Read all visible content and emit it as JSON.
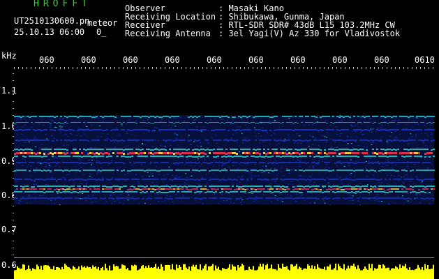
{
  "header": {
    "app_name": "HROFFT",
    "file_name": "UT2510130600.pn",
    "mode_label": "meteor",
    "datetime": "25.10.13 06:00",
    "count": "0_"
  },
  "info": {
    "observer_label": "Observer",
    "observer_value": ": Masaki Kano",
    "location_label": "Receiving Location",
    "location_value": ": Shibukawa, Gunma, Japan",
    "receiver_label": "Receiver",
    "receiver_value": ": RTL-SDR SDR# 43dB L15 103.2MHz CW",
    "antenna_label": "Receiving Antenna",
    "antenna_value": ": 3el Yagi(V) Az 330 for Vladivostok"
  },
  "axis": {
    "y_unit": "kHz",
    "y_ticks": [
      "1.1",
      "1.0",
      "0.9",
      "0.8",
      "0.7",
      "0.6"
    ],
    "x_ticks": [
      "060",
      "060",
      "060",
      "060",
      "060",
      "060",
      "060",
      "060",
      "060",
      "0610"
    ]
  },
  "colors": {
    "background": "#000000",
    "noise_blue": "#1a33c8",
    "signal_cyan": "#25d0c8",
    "signal_red": "#e8304a",
    "signal_yellow": "#ffff00",
    "header_green": "#2fd12f"
  }
}
